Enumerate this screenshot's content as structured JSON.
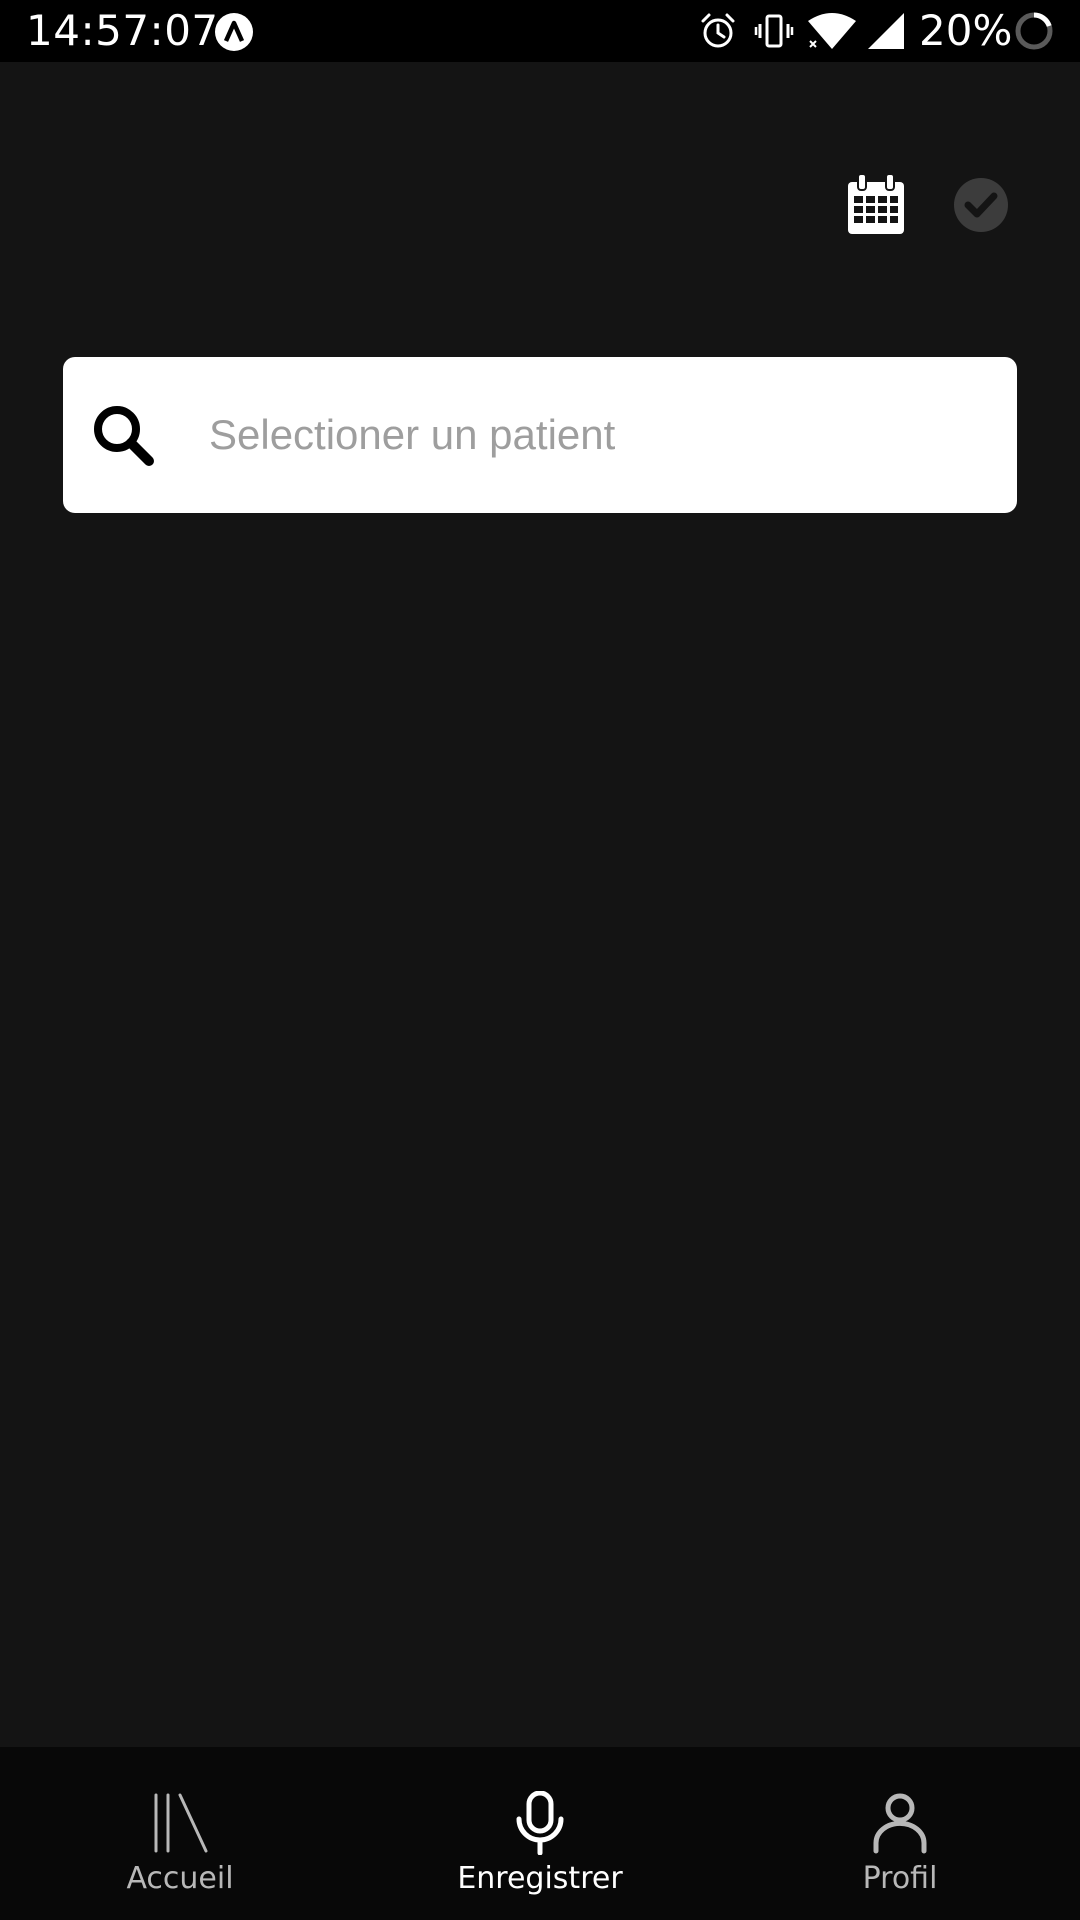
{
  "status_bar": {
    "time": "14:57:07",
    "battery_percent": "20%",
    "icons": [
      "app-notification-icon",
      "alarm-icon",
      "vibrate-icon",
      "wifi-icon",
      "cell-signal-icon",
      "battery-icon"
    ]
  },
  "header": {
    "icons": [
      "calendar-icon",
      "check-circle-icon"
    ]
  },
  "search": {
    "placeholder": "Selectioner un patient",
    "value": ""
  },
  "bottom_nav": {
    "items": [
      {
        "label": "Accueil",
        "icon": "library-icon",
        "active": false
      },
      {
        "label": "Enregistrer",
        "icon": "microphone-icon",
        "active": true
      },
      {
        "label": "Profil",
        "icon": "person-icon",
        "active": false
      }
    ]
  },
  "colors": {
    "background": "#141414",
    "status_bar": "#000000",
    "nav_background": "#080808",
    "search_background": "#ffffff",
    "placeholder": "#9e9e9e",
    "nav_inactive": "#b8b8b8",
    "nav_active": "#ffffff",
    "check_circle": "#3c3c3c"
  }
}
